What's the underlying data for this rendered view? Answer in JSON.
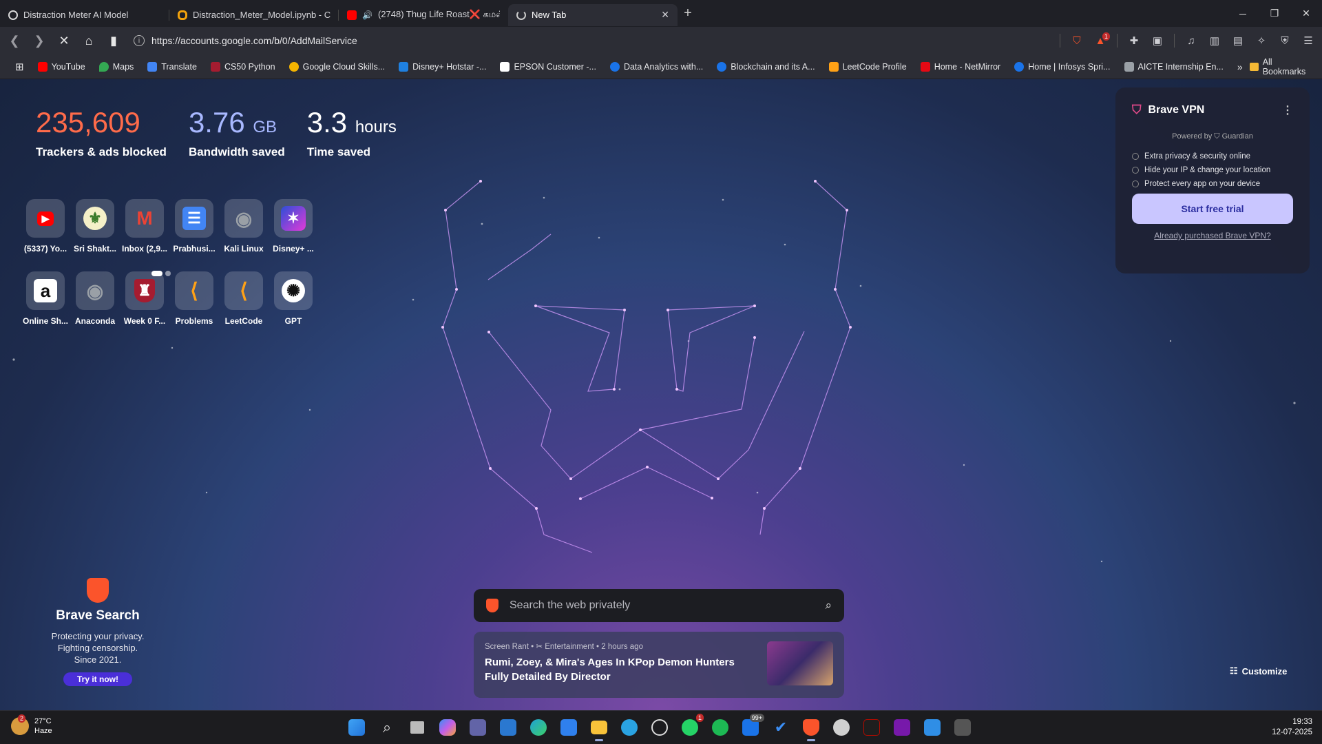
{
  "tabs": [
    {
      "title": "Distraction Meter AI Model",
      "favicon_color": "#d8d8d8",
      "icon": "openai-icon"
    },
    {
      "title": "Distraction_Meter_Model.ipynb - Col",
      "favicon_color": "#f2a20c",
      "icon": "colab-icon"
    },
    {
      "title": "(2748) Thug Life Roast❌ கமல்",
      "favicon_color": "#ff0000",
      "icon": "youtube-icon"
    },
    {
      "title": "New Tab",
      "favicon_color": "#cccccc",
      "icon": "loading-icon"
    }
  ],
  "address": {
    "url": "https://accounts.google.com/b/0/AddMailService"
  },
  "bookmarks": [
    {
      "label": "YouTube",
      "color": "#ff0000"
    },
    {
      "label": "Maps",
      "color": "#34a853"
    },
    {
      "label": "Translate",
      "color": "#4285f4"
    },
    {
      "label": "CS50 Python",
      "color": "#a51c30"
    },
    {
      "label": "Google Cloud Skills...",
      "color": "#f4b400"
    },
    {
      "label": "Disney+ Hotstar -...",
      "color": "#1f80e0"
    },
    {
      "label": "EPSON Customer -...",
      "color": "#ffffff"
    },
    {
      "label": "Data Analytics with...",
      "color": "#1a73e8"
    },
    {
      "label": "Blockchain and its A...",
      "color": "#1a73e8"
    },
    {
      "label": "LeetCode Profile",
      "color": "#ffa116"
    },
    {
      "label": "Home - NetMirror",
      "color": "#e50914"
    },
    {
      "label": "Home | Infosys Spri...",
      "color": "#1a73e8"
    },
    {
      "label": "AICTE Internship En...",
      "color": "#9aa0a6"
    }
  ],
  "all_bookmarks": "All Bookmarks",
  "stats": {
    "trackers": {
      "value": "235,609",
      "label": "Trackers & ads blocked",
      "color": "#ff6b4a"
    },
    "bandwidth": {
      "value": "3.76",
      "unit": "GB",
      "label": "Bandwidth saved",
      "color": "#a8b8ff"
    },
    "time": {
      "value": "3.3",
      "unit": "hours",
      "label": "Time saved",
      "color": "#ffffff"
    }
  },
  "top_sites": [
    {
      "name": "(5337) Yo...",
      "glyph": "▶",
      "bg": "#ff0000"
    },
    {
      "name": "Sri Shakt...",
      "glyph": "⚜",
      "bg": "#f5f0c8"
    },
    {
      "name": "Inbox (2,9...",
      "glyph": "M",
      "bg": "#ffffff"
    },
    {
      "name": "Prabhusi...",
      "glyph": "☰",
      "bg": "#4285f4"
    },
    {
      "name": "Kali Linux",
      "glyph": "◉",
      "bg": "#5f6368"
    },
    {
      "name": "Disney+ ...",
      "glyph": "✶",
      "bg": "#2b4fd8"
    },
    {
      "name": "Online Sh...",
      "glyph": "a",
      "bg": "#ffffff"
    },
    {
      "name": "Anaconda",
      "glyph": "◉",
      "bg": "#5f6368"
    },
    {
      "name": "Week 0 F...",
      "glyph": "♜",
      "bg": "#a51c30"
    },
    {
      "name": "Problems",
      "glyph": "⟨",
      "bg": "#2d2d2d"
    },
    {
      "name": "LeetCode",
      "glyph": "⟨",
      "bg": "#2d2d2d"
    },
    {
      "name": "GPT",
      "glyph": "✺",
      "bg": "#ffffff"
    }
  ],
  "vpn": {
    "title": "Brave VPN",
    "powered": "Powered by ⛉ Guardian",
    "features": [
      "Extra privacy & security online",
      "Hide your IP & change your location",
      "Protect every app on your device"
    ],
    "cta": "Start free trial",
    "link": "Already purchased Brave VPN?"
  },
  "brave_search": {
    "title": "Brave Search",
    "desc_lines": [
      "Protecting your privacy.",
      "Fighting censorship.",
      "Since 2021."
    ],
    "cta": "Try it now!"
  },
  "search": {
    "placeholder": "Search the web privately"
  },
  "news": {
    "source": "Screen Rant",
    "category": "Entertainment",
    "time": "2 hours ago",
    "headline": "Rumi, Zoey, & Mira's Ages In KPop Demon Hunters Fully Detailed By Director"
  },
  "customize": "Customize",
  "taskbar": {
    "weather": {
      "temp": "27°C",
      "cond": "Haze",
      "badge": "2"
    },
    "apps": [
      {
        "name": "start",
        "color": "#3fa3f5"
      },
      {
        "name": "search",
        "color": "#dddddd"
      },
      {
        "name": "task-view",
        "color": "#cccccc"
      },
      {
        "name": "copilot",
        "color": "#8a6cf0"
      },
      {
        "name": "teams",
        "color": "#6264a7"
      },
      {
        "name": "widgets",
        "color": "#2a78d0"
      },
      {
        "name": "edge",
        "color": "#1fa2d6"
      },
      {
        "name": "store",
        "color": "#2f80ed"
      },
      {
        "name": "explorer",
        "color": "#f8c23a"
      },
      {
        "name": "telegram",
        "color": "#2aa3e2"
      },
      {
        "name": "media",
        "color": "#dddddd"
      },
      {
        "name": "whatsapp",
        "color": "#25d366",
        "badge": "1"
      },
      {
        "name": "spotify",
        "color": "#1db954"
      },
      {
        "name": "outlook",
        "color": "#1a73e8",
        "badge": "99+"
      },
      {
        "name": "todo",
        "color": "#3b8ef5"
      },
      {
        "name": "brave",
        "color": "#fb542b"
      },
      {
        "name": "chatgpt",
        "color": "#d0d0d0"
      },
      {
        "name": "acrobat",
        "color": "#b30b00"
      },
      {
        "name": "onenote",
        "color": "#7719aa"
      },
      {
        "name": "vscode",
        "color": "#2f8ee6"
      },
      {
        "name": "terminal",
        "color": "#555555"
      }
    ],
    "time": "19:33",
    "date": "12-07-2025"
  }
}
